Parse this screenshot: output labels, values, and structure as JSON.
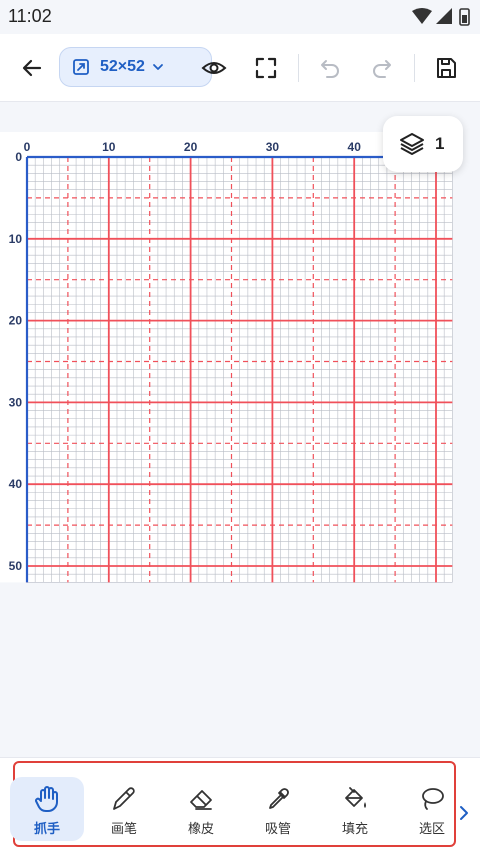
{
  "status": {
    "time": "11:02"
  },
  "toolbar": {
    "size_label": "52×52",
    "icons": [
      "back-arrow-icon",
      "resize-icon",
      "chevron-down-icon",
      "eye-icon",
      "fullscreen-icon",
      "undo-icon",
      "redo-icon",
      "save-icon"
    ]
  },
  "canvas": {
    "grid_cells": 52,
    "major_every": 10,
    "minor_dashed_every": 5,
    "x_ticks": [
      "0",
      "10",
      "20",
      "30",
      "40"
    ],
    "y_ticks": [
      "0",
      "10",
      "20",
      "30",
      "40",
      "50"
    ],
    "colors": {
      "major": "#f0505a",
      "fine": "#b9bdc6",
      "axis": "#2a5cc8"
    }
  },
  "layers": {
    "count": "1",
    "icon": "layers-icon"
  },
  "tools": [
    {
      "label": "抓手",
      "icon": "hand-icon",
      "active": true
    },
    {
      "label": "画笔",
      "icon": "pencil-icon",
      "active": false
    },
    {
      "label": "橡皮",
      "icon": "eraser-icon",
      "active": false
    },
    {
      "label": "吸管",
      "icon": "eyedropper-icon",
      "active": false
    },
    {
      "label": "填充",
      "icon": "fill-bucket-icon",
      "active": false
    },
    {
      "label": "选区",
      "icon": "lasso-icon",
      "active": false
    }
  ],
  "accent": "#1f5fc4"
}
